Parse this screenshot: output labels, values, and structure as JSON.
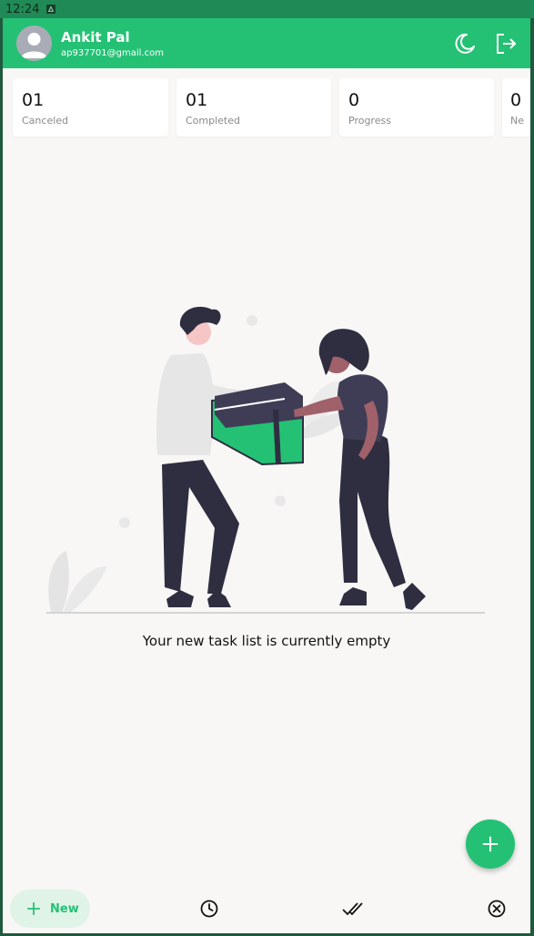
{
  "status_bar": {
    "time": "12:24"
  },
  "header": {
    "user_name": "Ankit Pal",
    "user_email": "ap937701@gmail.com",
    "theme_icon": "moon-icon",
    "logout_icon": "logout-icon"
  },
  "stats": [
    {
      "count": "01",
      "label": "Canceled"
    },
    {
      "count": "01",
      "label": "Completed"
    },
    {
      "count": "0",
      "label": "Progress"
    },
    {
      "count": "0",
      "label": "Ne"
    }
  ],
  "empty_state": {
    "message": "Your new task list is currently empty"
  },
  "fab": {
    "icon": "plus-icon"
  },
  "bottom_nav": {
    "new_label": "New",
    "items": [
      "plus-icon",
      "clock-icon",
      "double-check-icon",
      "cancel-circle-icon"
    ]
  },
  "colors": {
    "primary": "#24c174",
    "status_bar": "#1f8a55",
    "background": "#f8f7f5",
    "pill": "#dff3e7"
  }
}
